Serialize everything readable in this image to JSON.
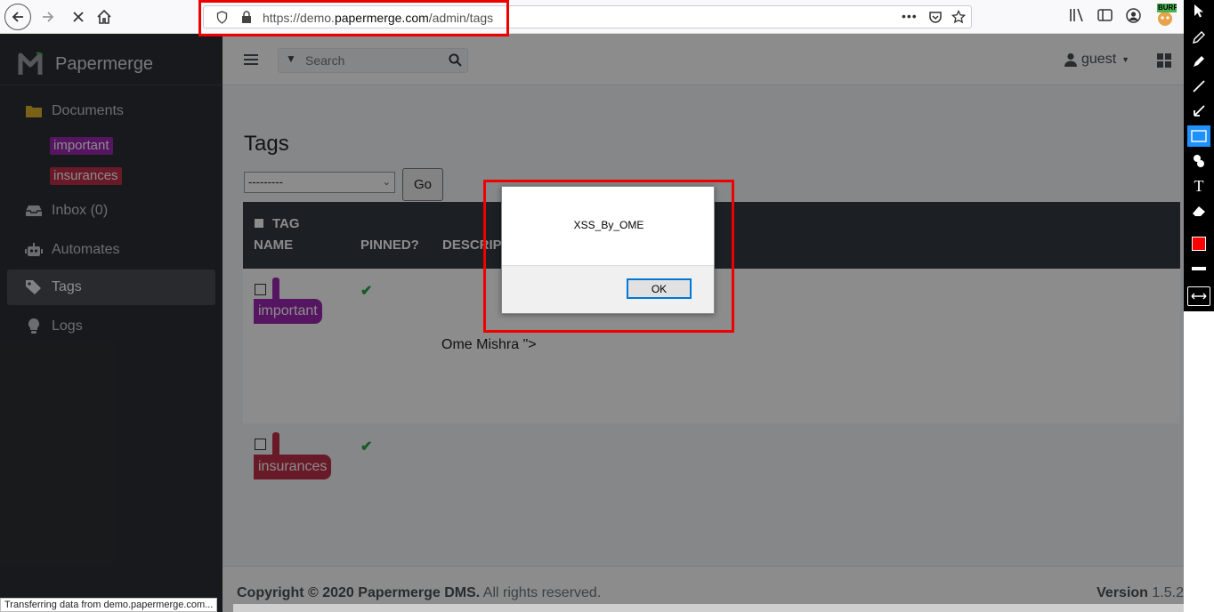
{
  "browser": {
    "url_prefix": "https://demo.",
    "url_domain": "papermerge.com",
    "url_path": "/admin/tags",
    "extension_badge": "BURP"
  },
  "sidebar": {
    "brand": "Papermerge",
    "items": [
      {
        "label": "Documents",
        "icon": "folder-icon"
      },
      {
        "label": "Inbox (0)",
        "icon": "inbox-icon"
      },
      {
        "label": "Automates",
        "icon": "robot-icon"
      },
      {
        "label": "Tags",
        "icon": "tags-icon",
        "active": true
      },
      {
        "label": "Logs",
        "icon": "lightbulb-icon"
      }
    ],
    "tags": [
      {
        "label": "important",
        "color": "#9c27b0"
      },
      {
        "label": "insurances",
        "color": "#c0304a"
      }
    ]
  },
  "topnav": {
    "search_placeholder": "Search",
    "user": "guest"
  },
  "main": {
    "title": "Tags",
    "action_select": "---------",
    "go_label": "Go",
    "columns": {
      "tag": "TAG",
      "name": "NAME",
      "pinned": "PINNED?",
      "description": "DESCRIPTION"
    },
    "rows": [
      {
        "name": "important",
        "color": "#9c27b0",
        "pinned": "✔",
        "description": "Ome Mishra \">"
      },
      {
        "name": "insurances",
        "color": "#c0304a",
        "pinned": "✔",
        "description": ""
      }
    ]
  },
  "footer": {
    "copyright": "Copyright © 2020",
    "company": "Papermerge DMS.",
    "rights": "All rights reserved.",
    "version_label": "Version",
    "version": "1.5.2"
  },
  "dialog": {
    "message": "XSS_By_OME",
    "ok_label": "OK"
  },
  "status": "Transferring data from demo.papermerge.com..."
}
